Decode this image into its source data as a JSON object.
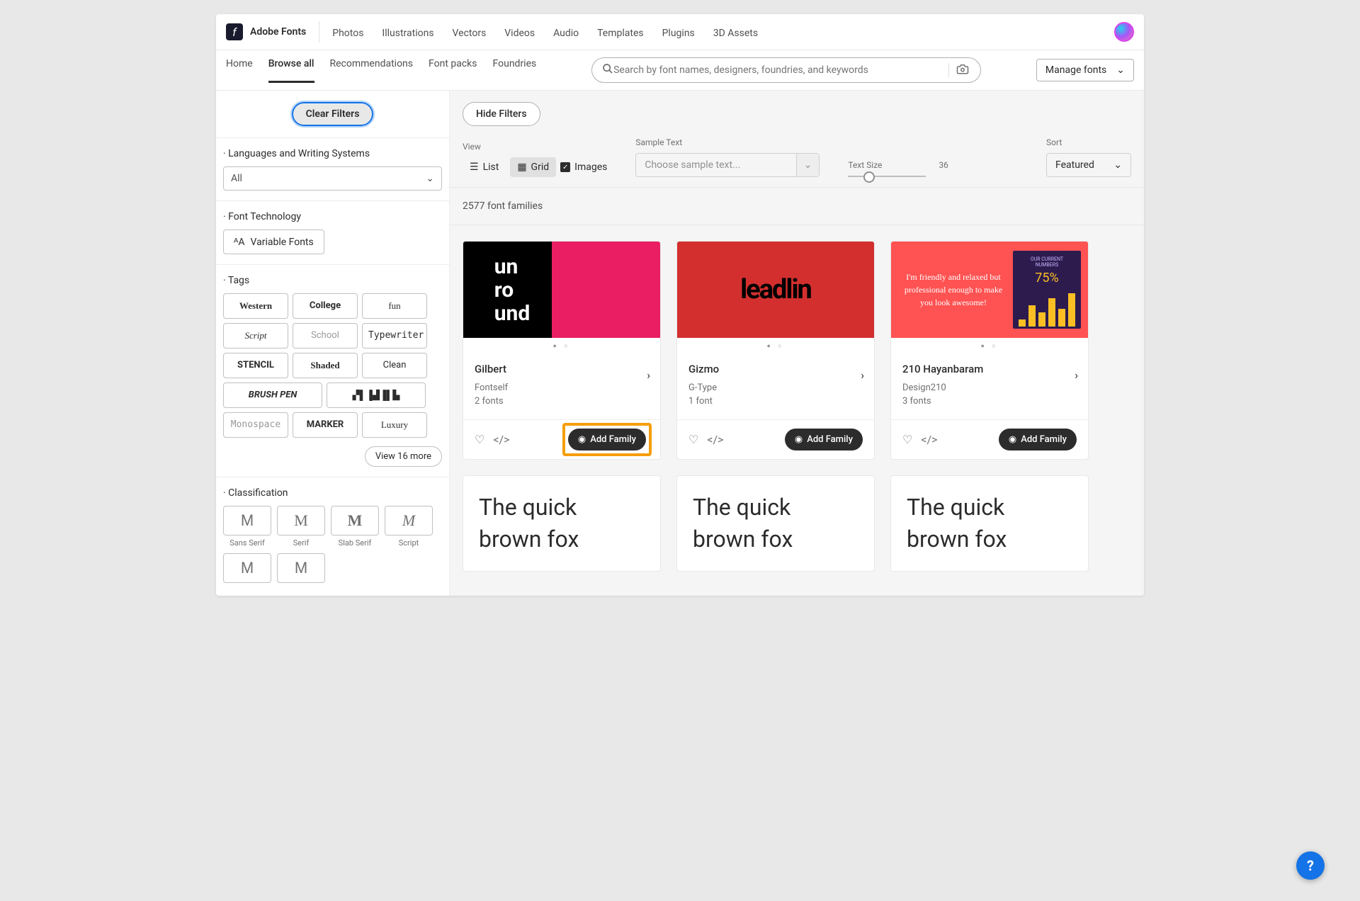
{
  "brand": "Adobe Fonts",
  "logo_glyph": "f",
  "top_nav": [
    "Photos",
    "Illustrations",
    "Vectors",
    "Videos",
    "Audio",
    "Templates",
    "Plugins",
    "3D Assets"
  ],
  "sub_nav": {
    "items": [
      "Home",
      "Browse all",
      "Recommendations",
      "Font packs",
      "Foundries"
    ],
    "active": "Browse all"
  },
  "search_placeholder": "Search by font names, designers, foundries, and keywords",
  "manage_label": "Manage fonts",
  "sidebar": {
    "clear_filters": "Clear Filters",
    "languages": {
      "title": "Languages and Writing Systems",
      "value": "All"
    },
    "font_tech": {
      "title": "Font Technology",
      "variable_label": "Variable Fonts"
    },
    "tags": {
      "title": "Tags",
      "items": [
        "Western",
        "College",
        "fun",
        "Script",
        "School",
        "Typewriter",
        "STENCIL",
        "Shaded",
        "Clean",
        "BRUSH PEN",
        "▞▌▐▟▐▌▙",
        "Monospace",
        "MARKER",
        "Luxury"
      ],
      "view_more": "View 16 more"
    },
    "classification": {
      "title": "Classification",
      "items": [
        {
          "glyph": "M",
          "label": "Sans Serif"
        },
        {
          "glyph": "M",
          "label": "Serif"
        },
        {
          "glyph": "M",
          "label": "Slab Serif"
        },
        {
          "glyph": "M",
          "label": "Script"
        },
        {
          "glyph": "M",
          "label": ""
        },
        {
          "glyph": "M",
          "label": ""
        }
      ]
    }
  },
  "main": {
    "hide_filters": "Hide Filters",
    "controls": {
      "view_label": "View",
      "list_label": "List",
      "grid_label": "Grid",
      "images_label": "Images",
      "sample_label": "Sample Text",
      "sample_placeholder": "Choose sample text...",
      "size_label": "Text Size",
      "size_value": "36",
      "sort_label": "Sort",
      "sort_value": "Featured"
    },
    "count": "2577 font families",
    "cards": [
      {
        "img_text": "un\nro\nund",
        "title": "Gilbert",
        "foundry": "Fontself",
        "fonts": "2 fonts",
        "add": "Add Family",
        "highlighted": true
      },
      {
        "img_text": "leadlin",
        "title": "Gizmo",
        "foundry": "G-Type",
        "fonts": "1 font",
        "add": "Add Family",
        "highlighted": false
      },
      {
        "img_text_left": "I'm friendly and relaxed but professional enough to make you look awesome!",
        "title": "210 Hayanbaram",
        "foundry": "Design210",
        "fonts": "3 fonts",
        "add": "Add Family",
        "highlighted": false
      }
    ],
    "text_cards": [
      "The quick brown fox",
      "The quick brown fox",
      "The quick brown fox"
    ]
  },
  "help": "?"
}
